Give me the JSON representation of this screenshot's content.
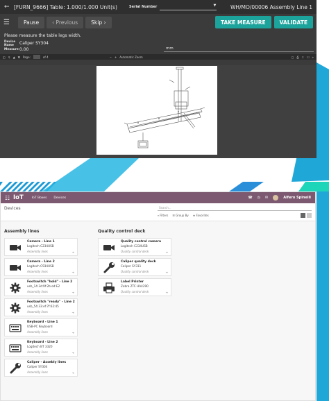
{
  "work_order": {
    "title": "[FURN_9666] Table: 1.000/1.000 Unit(s)",
    "serial_label": "Serial Number",
    "reference": "WH/MO/00006 Assembly Line 1",
    "buttons": {
      "pause": "Pause",
      "previous": "Previous",
      "skip": "Skip",
      "take_measure": "TAKE MEASURE",
      "validate": "VALIDATE"
    },
    "instruction": "Please measure the table legs width.",
    "device_label": "Device Name",
    "device_value": "Caliper SY304",
    "measure_label": "Measure",
    "measure_value": "0.00",
    "unit": "mm",
    "pdf": {
      "page_label": "Page:",
      "page_num": "1",
      "page_of": "of 4",
      "zoom": "Automatic Zoom"
    },
    "colors": {
      "accent": "#1ba39c",
      "dark_bg": "#3b3b3b"
    }
  },
  "iot": {
    "app_name": "IoT",
    "menu": [
      "IoT Boxes",
      "Devices"
    ],
    "user": "Alfero Spinelli",
    "breadcrumb": "Devices",
    "search_placeholder": "Search...",
    "filters": [
      "Filters",
      "Group By",
      "Favorites"
    ],
    "groups": [
      {
        "title": "Assembly lines",
        "devices": [
          {
            "name": "Camera - Line 1",
            "desc": "Logitech C234USB",
            "loc": "Assembly lines",
            "icon": "camera-icon"
          },
          {
            "name": "Camera - Line 2",
            "desc": "Logitech C934USB",
            "loc": "Assembly lines",
            "icon": "camera-icon"
          },
          {
            "name": "Footswitch \"hold\" - Line 2",
            "desc": "usb_14:3d:9f:2b:ed:E2",
            "loc": "Assembly lines",
            "icon": "gear-icon"
          },
          {
            "name": "Footswitch \"ready\" - Line 2",
            "desc": "usb_54:33:ef:7f:62:45",
            "loc": "Assembly lines",
            "icon": "gear-icon"
          },
          {
            "name": "Keyboard - Line 1",
            "desc": "USB-PC Keyboard",
            "loc": "Assembly lines",
            "icon": "keyboard-icon"
          },
          {
            "name": "Keyboard - Line 2",
            "desc": "Logitech BT 3320",
            "loc": "Assembly lines",
            "icon": "keyboard-icon"
          },
          {
            "name": "Caliper - Assebly lines",
            "desc": "Caliper SY304",
            "loc": "Assembly lines",
            "icon": "wrench-icon"
          }
        ]
      },
      {
        "title": "Quality control deck",
        "devices": [
          {
            "name": "Quality control camera",
            "desc": "Logitech C234USB",
            "loc": "Quality control deck",
            "icon": "camera-icon"
          },
          {
            "name": "Caliper quality deck",
            "desc": "Caliper SY311",
            "loc": "Quality control deck",
            "icon": "wrench-icon"
          },
          {
            "name": "Label Printer",
            "desc": "Zebra ZTC HA4290",
            "loc": "Quality control deck",
            "icon": "printer-icon"
          }
        ]
      }
    ],
    "colors": {
      "nav": "#7c5970"
    }
  }
}
